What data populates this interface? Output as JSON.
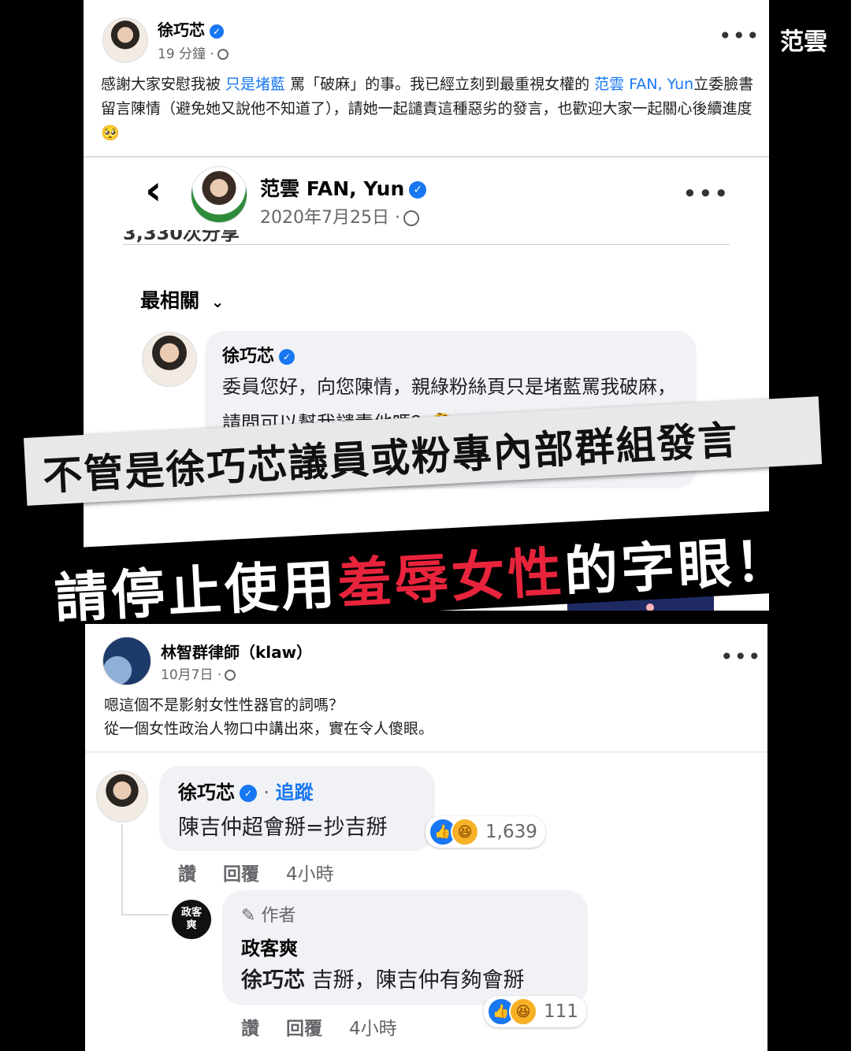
{
  "brand": {
    "label": "范雲",
    "icon": "raised-hands-icon"
  },
  "post1": {
    "author": "徐巧芯",
    "time": "19 分鐘",
    "text_a": "感謝大家安慰我被 ",
    "mention_a": "只是堵藍",
    "text_b": " 罵「破麻」的事。我已經立刻到最重視女權的 ",
    "mention_b": "范雲 FAN, Yun",
    "text_c": "立委臉書留言陳情（避免她又說他不知道了），請她一起譴責這種惡劣的發言，也歡迎大家一起關心後續進度",
    "emoji": "🥺"
  },
  "fan_post": {
    "back_icon": "‹",
    "author": "范雲 FAN, Yun",
    "date": "2020年7月25日",
    "cut_text": "3,330次分享",
    "filter_label": "最相關",
    "comment_author": "徐巧芯",
    "comment_text": "委員您好，向您陳情，親綠粉絲頁只是堵藍罵我破麻，請問可以幫我譴責他嗎？",
    "comment_emoji": "🤔"
  },
  "banner": {
    "line1": "不管是徐巧芯議員或粉專內部群組發言",
    "line2_a": "請停止使用",
    "line2_highlight": "羞辱女性",
    "line2_b": "的字眼！",
    "highlight_color": "#e8243c"
  },
  "post2": {
    "author": "林智群律師（klaw）",
    "date": "10月7日",
    "line1": "嗯這個不是影射女性性器官的詞嗎？",
    "line2": "從一個女性政治人物口中講出來，實在令人傻眼。"
  },
  "comment": {
    "author": "徐巧芯",
    "follow_label": "追蹤",
    "text": "陳吉仲超會掰=抄吉掰",
    "reaction_count": "1,639",
    "like_label": "讚",
    "reply_label": "回覆",
    "time": "4小時"
  },
  "reply": {
    "role_label": "作者",
    "author": "政客爽",
    "mention": "徐巧芯",
    "text": " 吉掰，陳吉仲有夠會掰",
    "reaction_count": "111",
    "like_label": "讚",
    "reply_label": "回覆",
    "time": "4小時",
    "avatar_text": "政客爽"
  },
  "colors": {
    "fb_blue": "#1877f2",
    "gray_text": "#65676b",
    "bubble_bg": "#f0f2f5"
  }
}
